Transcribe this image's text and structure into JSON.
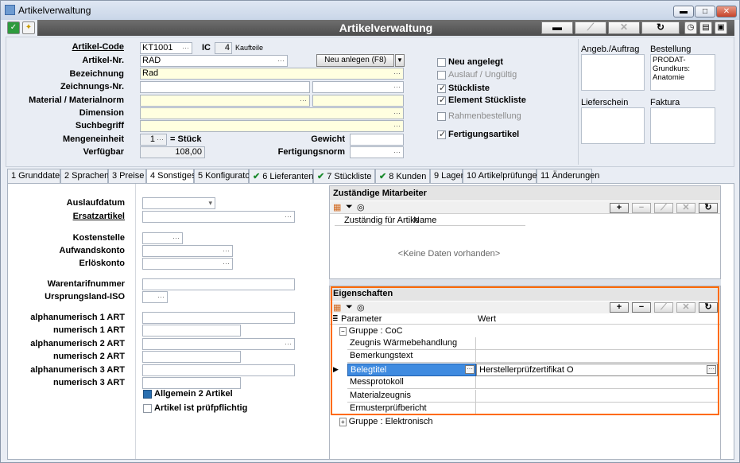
{
  "window": {
    "title": "Artikelverwaltung",
    "min": "▬",
    "max": "□",
    "close": "✕"
  },
  "header": {
    "title": "Artikelverwaltung",
    "btn_remove": "▬",
    "btn_edit": "⟋",
    "btn_cancel": "✕",
    "btn_refresh": "↻"
  },
  "form": {
    "artikel_code_label": "Artikel-Code",
    "artikel_code": "KT1001",
    "ic_label": "IC",
    "ic_value": "4",
    "ic_text": "Kaufteile",
    "artikel_nr_label": "Artikel-Nr.",
    "artikel_nr": "RAD",
    "neu_anlegen": "Neu anlegen (F8)",
    "bezeichnung_label": "Bezeichnung",
    "bezeichnung": "Rad",
    "zeichnungs_label": "Zeichnungs-Nr.",
    "material_label": "Material / Materialnorm",
    "dimension_label": "Dimension",
    "suchbegriff_label": "Suchbegriff",
    "mengeneinheit_label": "Mengeneinheit",
    "mengeneinheit_qty": "1",
    "mengeneinheit_unit": "= Stück",
    "verfuegbar_label": "Verfügbar",
    "verfuegbar": "108,00",
    "gewicht_label": "Gewicht",
    "fertigungsnorm_label": "Fertigungsnorm"
  },
  "checks": [
    {
      "label": "Neu angelegt",
      "checked": false,
      "dim": false
    },
    {
      "label": "Auslauf / Ungültig",
      "checked": false,
      "dim": true
    },
    {
      "label": "Stückliste",
      "checked": true,
      "dim": false
    },
    {
      "label": "Element Stückliste",
      "checked": true,
      "dim": false
    },
    {
      "label": "Rahmenbestellung",
      "checked": false,
      "dim": true
    },
    {
      "label": "Fertigungsartikel",
      "checked": true,
      "dim": false
    }
  ],
  "docs": {
    "angebot_label": "Angeb./Auftrag",
    "bestellung_label": "Bestellung",
    "bestellung_text": "PRODAT-Grundkurs: Anatomie",
    "lieferschein_label": "Lieferschein",
    "faktura_label": "Faktura"
  },
  "tabs": [
    {
      "label": "1 Grunddaten",
      "check": false
    },
    {
      "label": "2 Sprachen",
      "check": false
    },
    {
      "label": "3 Preise",
      "check": false
    },
    {
      "label": "4 Sonstiges",
      "check": false
    },
    {
      "label": "5 Konfigurator",
      "check": false
    },
    {
      "label": "6 Lieferanten",
      "check": true
    },
    {
      "label": "7 Stückliste",
      "check": true
    },
    {
      "label": "8 Kunden",
      "check": true
    },
    {
      "label": "9 Lager",
      "check": false
    },
    {
      "label": "10 Artikelprüfungen",
      "check": false
    },
    {
      "label": "11 Änderungen",
      "check": false
    }
  ],
  "sonstiges": {
    "auslaufdatum": "Auslaufdatum",
    "ersatzartikel": "Ersatzartikel",
    "kostenstelle": "Kostenstelle",
    "aufwandskonto": "Aufwandskonto",
    "erloeskonto": "Erlöskonto",
    "warentarif": "Warentarifnummer",
    "ursprungsland": "Ursprungsland-ISO",
    "alpha1": "alphanumerisch 1 ART",
    "num1": "numerisch 1 ART",
    "alpha2": "alphanumerisch 2 ART",
    "num2": "numerisch 2 ART",
    "alpha3": "alphanumerisch 3 ART",
    "num3": "numerisch 3 ART",
    "allgemein2": "Allgemein 2 Artikel",
    "pruefpflichtig": "Artikel ist prüfpflichtig"
  },
  "mitarbeiter": {
    "title": "Zuständige Mitarbeiter",
    "col1": "Zuständig für Artike",
    "col2": "Name",
    "empty": "<Keine Daten vorhanden>"
  },
  "eigenschaften": {
    "title": "Eigenschaften",
    "col_param": "Parameter",
    "col_wert": "Wert",
    "group1": "Gruppe : CoC",
    "group2": "Gruppe : Elektronisch",
    "rows": [
      {
        "param": "Zeugnis Wärmebehandlung",
        "wert": ""
      },
      {
        "param": "Bemerkungstext",
        "wert": ""
      },
      {
        "param": "Belegtitel",
        "wert": "Herstellerprüfzertifikat O"
      },
      {
        "param": "Messprotokoll",
        "wert": ""
      },
      {
        "param": "Materialzeugnis",
        "wert": ""
      },
      {
        "param": "Ermusterprüfbericht",
        "wert": ""
      }
    ]
  },
  "colors": {
    "highlight": "#ff6a00",
    "selected": "#3f8be0",
    "header": "#5a5a5a"
  }
}
